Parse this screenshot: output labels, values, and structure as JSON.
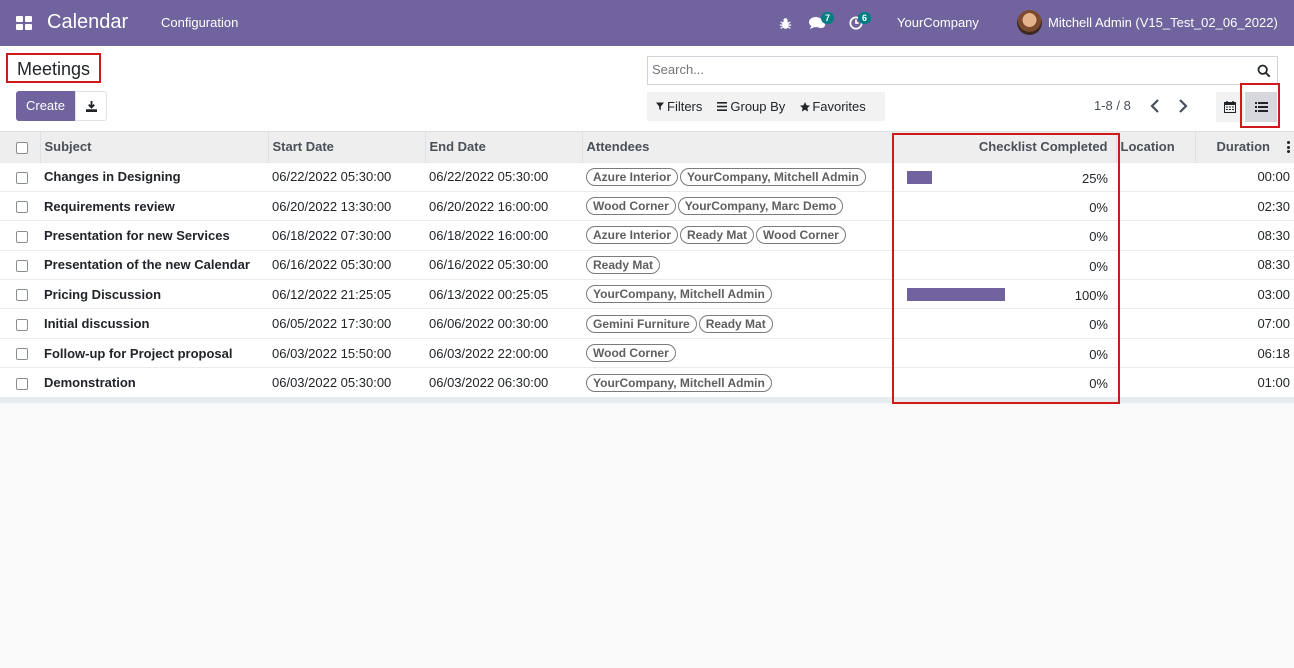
{
  "navbar": {
    "app_name": "Calendar",
    "menu_configuration": "Configuration",
    "chat_count": "7",
    "activity_count": "6",
    "company": "YourCompany",
    "user": "Mitchell Admin (V15_Test_02_06_2022)",
    "bg_color": "#71639e"
  },
  "control_panel": {
    "title": "Meetings",
    "create_label": "Create",
    "search_placeholder": "Search...",
    "filters_label": "Filters",
    "group_by_label": "Group By",
    "favorites_label": "Favorites",
    "pager": "1-8 / 8"
  },
  "table": {
    "headers": {
      "subject": "Subject",
      "start_date": "Start Date",
      "end_date": "End Date",
      "attendees": "Attendees",
      "checklist": "Checklist Completed",
      "location": "Location",
      "duration": "Duration"
    },
    "rows": [
      {
        "subject": "Changes in Designing",
        "start": "06/22/2022 05:30:00",
        "end": "06/22/2022 05:30:00",
        "attendees": [
          "Azure Interior",
          "YourCompany, Mitchell Admin"
        ],
        "progress": 25,
        "progress_label": "25%",
        "location": "",
        "duration": "00:00"
      },
      {
        "subject": "Requirements review",
        "start": "06/20/2022 13:30:00",
        "end": "06/20/2022 16:00:00",
        "attendees": [
          "Wood Corner",
          "YourCompany, Marc Demo"
        ],
        "progress": 0,
        "progress_label": "0%",
        "location": "",
        "duration": "02:30"
      },
      {
        "subject": "Presentation for new Services",
        "start": "06/18/2022 07:30:00",
        "end": "06/18/2022 16:00:00",
        "attendees": [
          "Azure Interior",
          "Ready Mat",
          "Wood Corner"
        ],
        "progress": 0,
        "progress_label": "0%",
        "location": "",
        "duration": "08:30"
      },
      {
        "subject": "Presentation of the new Calendar",
        "start": "06/16/2022 05:30:00",
        "end": "06/16/2022 05:30:00",
        "attendees": [
          "Ready Mat"
        ],
        "progress": 0,
        "progress_label": "0%",
        "location": "",
        "duration": "08:30"
      },
      {
        "subject": "Pricing Discussion",
        "start": "06/12/2022 21:25:05",
        "end": "06/13/2022 00:25:05",
        "attendees": [
          "YourCompany, Mitchell Admin"
        ],
        "progress": 100,
        "progress_label": "100%",
        "location": "",
        "duration": "03:00"
      },
      {
        "subject": "Initial discussion",
        "start": "06/05/2022 17:30:00",
        "end": "06/06/2022 00:30:00",
        "attendees": [
          "Gemini Furniture",
          "Ready Mat"
        ],
        "progress": 0,
        "progress_label": "0%",
        "location": "",
        "duration": "07:00"
      },
      {
        "subject": "Follow-up for Project proposal",
        "start": "06/03/2022 15:50:00",
        "end": "06/03/2022 22:00:00",
        "attendees": [
          "Wood Corner"
        ],
        "progress": 0,
        "progress_label": "0%",
        "location": "",
        "duration": "06:18"
      },
      {
        "subject": "Demonstration",
        "start": "06/03/2022 05:30:00",
        "end": "06/03/2022 06:30:00",
        "attendees": [
          "YourCompany, Mitchell Admin"
        ],
        "progress": 0,
        "progress_label": "0%",
        "location": "",
        "duration": "01:00"
      }
    ]
  }
}
